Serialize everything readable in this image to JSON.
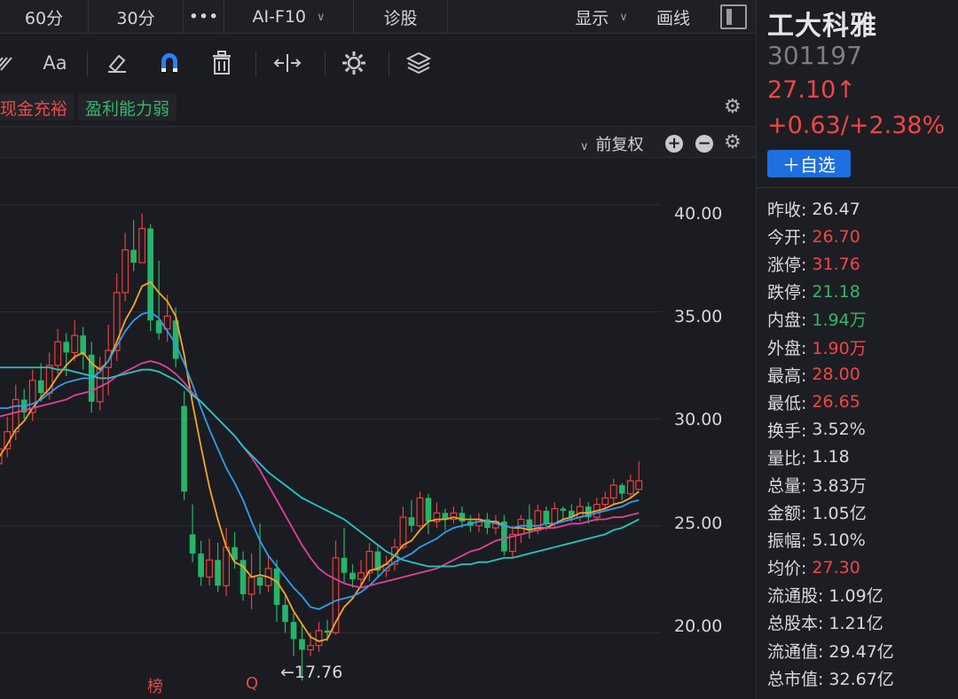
{
  "topbar": {
    "tabs": [
      {
        "label": "60分"
      },
      {
        "label": "30分"
      },
      {
        "label": "•••"
      },
      {
        "label": "AI-F10"
      },
      {
        "label": "诊股"
      }
    ],
    "display_label": "显示",
    "draw_label": "画线"
  },
  "toolbar": {
    "font_label": "Aa"
  },
  "tags": {
    "cash": "现金充裕",
    "profit": "盈利能力弱"
  },
  "chart_header": {
    "adjust_label": "前复权"
  },
  "chart_data": {
    "type": "candlestick",
    "y_ticks": [
      "40.00",
      "35.00",
      "30.00",
      "25.00",
      "20.00"
    ],
    "ylim": [
      16.9,
      42.2
    ],
    "low_marker": "←17.76",
    "markers": [
      "榜",
      "Q"
    ],
    "candles": [
      [
        27.9,
        28.6,
        28.9,
        27.6
      ],
      [
        28.6,
        29.4,
        30.1,
        28.2
      ],
      [
        29.4,
        30.9,
        31.6,
        29.0
      ],
      [
        30.9,
        30.3,
        31.4,
        30.0
      ],
      [
        30.3,
        31.8,
        32.3,
        29.9
      ],
      [
        31.8,
        31.2,
        32.6,
        30.8
      ],
      [
        31.2,
        32.5,
        33.1,
        30.9
      ],
      [
        32.5,
        33.6,
        34.2,
        32.1
      ],
      [
        33.6,
        33.1,
        34.0,
        32.0
      ],
      [
        33.1,
        33.9,
        34.6,
        32.7
      ],
      [
        33.9,
        33.0,
        34.3,
        32.3
      ],
      [
        33.0,
        30.8,
        33.6,
        30.3
      ],
      [
        30.8,
        32.4,
        32.9,
        30.4
      ],
      [
        32.4,
        33.2,
        34.4,
        31.1
      ],
      [
        33.2,
        35.9,
        36.8,
        32.7
      ],
      [
        35.9,
        37.9,
        38.7,
        35.5
      ],
      [
        37.9,
        37.3,
        39.3,
        36.9
      ],
      [
        37.3,
        38.9,
        39.6,
        37.5
      ],
      [
        38.9,
        34.6,
        39.1,
        34.1
      ],
      [
        34.6,
        34.0,
        37.4,
        33.7
      ],
      [
        34.2,
        34.8,
        35.8,
        33.6
      ],
      [
        34.6,
        32.8,
        35.2,
        32.4
      ],
      [
        30.6,
        26.6,
        31.3,
        26.2
      ],
      [
        24.6,
        23.7,
        26.0,
        23.3
      ],
      [
        23.7,
        22.6,
        24.3,
        22.2
      ],
      [
        22.6,
        23.4,
        24.4,
        22.2
      ],
      [
        23.4,
        22.2,
        24.2,
        21.9
      ],
      [
        22.2,
        24.0,
        24.9,
        21.7
      ],
      [
        24.0,
        23.4,
        24.7,
        23.0
      ],
      [
        23.4,
        21.8,
        23.8,
        21.5
      ],
      [
        21.8,
        22.6,
        23.7,
        21.1
      ],
      [
        22.6,
        22.2,
        25.1,
        21.8
      ],
      [
        22.2,
        23.0,
        23.6,
        21.9
      ],
      [
        23.0,
        21.3,
        23.4,
        20.5
      ],
      [
        21.3,
        20.5,
        21.8,
        20.0
      ],
      [
        20.5,
        19.7,
        20.9,
        18.9
      ],
      [
        19.7,
        19.2,
        20.4,
        17.76
      ],
      [
        19.2,
        19.4,
        20.0,
        18.9
      ],
      [
        19.4,
        20.1,
        20.5,
        19.1
      ],
      [
        20.1,
        20.0,
        20.6,
        19.6
      ],
      [
        20.0,
        23.5,
        24.3,
        19.9
      ],
      [
        23.5,
        22.8,
        24.9,
        22.3
      ],
      [
        22.8,
        22.5,
        23.2,
        22.1
      ],
      [
        22.5,
        22.8,
        23.4,
        22.2
      ],
      [
        22.8,
        23.8,
        24.2,
        22.4
      ],
      [
        23.8,
        22.9,
        24.1,
        22.6
      ],
      [
        22.9,
        23.2,
        23.6,
        22.6
      ],
      [
        23.2,
        24.0,
        24.4,
        22.9
      ],
      [
        24.0,
        25.4,
        25.9,
        23.9
      ],
      [
        25.4,
        25.0,
        26.2,
        24.7
      ],
      [
        25.0,
        26.3,
        26.6,
        24.9
      ],
      [
        26.3,
        25.2,
        26.5,
        24.6
      ],
      [
        25.2,
        25.6,
        26.1,
        24.9
      ],
      [
        25.6,
        25.3,
        25.8,
        24.8
      ],
      [
        25.3,
        25.6,
        25.9,
        25.1
      ],
      [
        25.6,
        25.2,
        25.9,
        24.9
      ],
      [
        25.2,
        25.0,
        25.5,
        24.7
      ],
      [
        25.0,
        25.3,
        25.6,
        24.7
      ],
      [
        25.3,
        24.9,
        25.6,
        24.6
      ],
      [
        24.9,
        25.2,
        25.5,
        24.6
      ],
      [
        25.2,
        23.8,
        25.5,
        23.6
      ],
      [
        23.8,
        24.6,
        25.0,
        23.5
      ],
      [
        24.6,
        25.3,
        25.5,
        24.2
      ],
      [
        25.3,
        24.8,
        26.0,
        24.4
      ],
      [
        24.8,
        25.7,
        26.0,
        24.6
      ],
      [
        25.7,
        25.1,
        25.9,
        24.8
      ],
      [
        25.1,
        25.8,
        26.1,
        24.9
      ],
      [
        25.8,
        25.7,
        25.9,
        25.3
      ],
      [
        25.7,
        25.4,
        26.0,
        25.2
      ],
      [
        25.4,
        25.9,
        26.3,
        25.2
      ],
      [
        25.9,
        25.4,
        26.1,
        25.1
      ],
      [
        25.4,
        26.0,
        26.3,
        25.2
      ],
      [
        26.0,
        26.3,
        26.6,
        25.8
      ],
      [
        26.3,
        26.9,
        27.2,
        26.0
      ],
      [
        26.9,
        26.5,
        27.0,
        26.2
      ],
      [
        26.5,
        27.1,
        27.4,
        26.3
      ],
      [
        26.7,
        27.1,
        28.0,
        26.65
      ]
    ],
    "ma_lines": [
      {
        "color": "#f5a623",
        "values": [
          28.2,
          28.8,
          29.5,
          29.9,
          30.5,
          31.0,
          31.4,
          32.0,
          32.5,
          32.9,
          33.1,
          32.6,
          32.3,
          32.7,
          33.6,
          34.6,
          35.3,
          36.2,
          36.4,
          35.9,
          35.5,
          34.8,
          33.0,
          30.7,
          28.7,
          26.8,
          25.3,
          24.0,
          23.3,
          23.1,
          22.6,
          22.7,
          22.6,
          22.4,
          21.8,
          21.0,
          20.4,
          19.8,
          19.6,
          19.7,
          20.5,
          21.2,
          21.6,
          22.2,
          22.9,
          23.0,
          23.2,
          23.6,
          24.1,
          24.3,
          24.8,
          25.2,
          25.3,
          25.3,
          25.4,
          25.3,
          25.3,
          25.3,
          25.2,
          25.2,
          25.0,
          24.9,
          24.9,
          24.8,
          24.9,
          24.9,
          25.1,
          25.3,
          25.4,
          25.6,
          25.6,
          25.7,
          25.8,
          26.0,
          26.1,
          26.3,
          26.6
        ]
      },
      {
        "color": "#2e9ef0",
        "values": [
          30.5,
          30.5,
          30.6,
          30.6,
          30.7,
          30.9,
          31.2,
          31.5,
          31.7,
          31.8,
          31.9,
          31.9,
          32.2,
          32.7,
          33.4,
          34.1,
          34.6,
          34.9,
          35.0,
          34.7,
          34.1,
          33.5,
          32.6,
          31.6,
          30.5,
          29.5,
          28.6,
          27.7,
          27.0,
          26.2,
          25.2,
          24.3,
          23.6,
          23.1,
          22.6,
          22.1,
          21.7,
          21.2,
          21.1,
          21.3,
          21.5,
          21.6,
          21.7,
          21.9,
          22.2,
          22.6,
          23.0,
          23.3,
          23.5,
          23.7,
          24.0,
          24.2,
          24.4,
          24.7,
          24.9,
          25.0,
          25.1,
          25.2,
          25.2,
          25.1,
          25.0,
          24.9,
          25.0,
          25.0,
          25.0,
          25.1,
          25.1,
          25.2,
          25.3,
          25.4,
          25.5,
          25.6,
          25.7,
          25.8,
          25.9,
          26.1,
          26.2
        ]
      },
      {
        "color": "#e0409f",
        "values": [
          30.1,
          30.2,
          30.3,
          30.4,
          30.5,
          30.6,
          30.7,
          30.8,
          30.9,
          31.1,
          31.2,
          31.3,
          31.5,
          31.7,
          32.0,
          32.2,
          32.4,
          32.6,
          32.7,
          32.6,
          32.4,
          32.1,
          31.7,
          31.2,
          30.8,
          30.4,
          30.0,
          29.6,
          29.2,
          28.7,
          28.2,
          27.6,
          26.9,
          26.2,
          25.5,
          24.8,
          24.1,
          23.5,
          23.0,
          22.7,
          22.5,
          22.3,
          22.2,
          22.1,
          22.2,
          22.3,
          22.4,
          22.5,
          22.6,
          22.7,
          22.8,
          22.9,
          23.0,
          23.2,
          23.4,
          23.6,
          23.8,
          23.9,
          24.1,
          24.3,
          24.4,
          24.5,
          24.6,
          24.7,
          24.8,
          24.9,
          24.9,
          25.0,
          25.1,
          25.1,
          25.2,
          25.3,
          25.3,
          25.4,
          25.4,
          25.5,
          25.6
        ]
      },
      {
        "color": "#26c6c6",
        "values": [
          32.4,
          32.4,
          32.4,
          32.4,
          32.4,
          32.4,
          32.4,
          32.3,
          32.3,
          32.2,
          32.1,
          32.0,
          31.9,
          31.9,
          32.0,
          32.1,
          32.2,
          32.3,
          32.3,
          32.2,
          32.0,
          31.8,
          31.5,
          31.1,
          30.8,
          30.4,
          30.0,
          29.6,
          29.2,
          28.7,
          28.3,
          27.9,
          27.5,
          27.2,
          26.9,
          26.6,
          26.3,
          26.1,
          25.9,
          25.7,
          25.5,
          25.3,
          25.0,
          24.7,
          24.4,
          24.1,
          23.8,
          23.6,
          23.4,
          23.3,
          23.2,
          23.1,
          23.1,
          23.1,
          23.1,
          23.2,
          23.2,
          23.3,
          23.3,
          23.4,
          23.5,
          23.5,
          23.6,
          23.7,
          23.8,
          23.9,
          24.0,
          24.1,
          24.2,
          24.3,
          24.4,
          24.5,
          24.6,
          24.8,
          24.9,
          25.1,
          25.3
        ]
      }
    ]
  },
  "panel": {
    "name": "工大科雅",
    "code": "301197",
    "price": "27.10↑",
    "change": "+0.63/+2.38%",
    "add_watch": "＋自选",
    "stats": [
      {
        "k": "昨收:",
        "v": "26.47",
        "c": ""
      },
      {
        "k": "今开:",
        "v": "26.70",
        "c": "red"
      },
      {
        "k": "涨停:",
        "v": "31.76",
        "c": "red"
      },
      {
        "k": "跌停:",
        "v": "21.18",
        "c": "green"
      },
      {
        "k": "内盘:",
        "v": "1.94万",
        "c": "green"
      },
      {
        "k": "外盘:",
        "v": "1.90万",
        "c": "red"
      },
      {
        "k": "最高:",
        "v": "28.00",
        "c": "red"
      },
      {
        "k": "最低:",
        "v": "26.65",
        "c": "red"
      },
      {
        "k": "换手:",
        "v": "3.52%",
        "c": ""
      },
      {
        "k": "量比:",
        "v": "1.18",
        "c": ""
      },
      {
        "k": "总量:",
        "v": "3.83万",
        "c": ""
      },
      {
        "k": "金额:",
        "v": "1.05亿",
        "c": ""
      },
      {
        "k": "振幅:",
        "v": "5.10%",
        "c": ""
      },
      {
        "k": "均价:",
        "v": "27.30",
        "c": "red"
      },
      {
        "k": "流通股:",
        "v": "1.09亿",
        "c": ""
      },
      {
        "k": "总股本:",
        "v": "1.21亿",
        "c": ""
      },
      {
        "k": "流通值:",
        "v": "29.47亿",
        "c": ""
      },
      {
        "k": "总市值:",
        "v": "32.67亿",
        "c": ""
      }
    ]
  },
  "colors": {
    "up": "#e8403f",
    "down": "#27b46a",
    "accent": "#1e6fe0"
  }
}
